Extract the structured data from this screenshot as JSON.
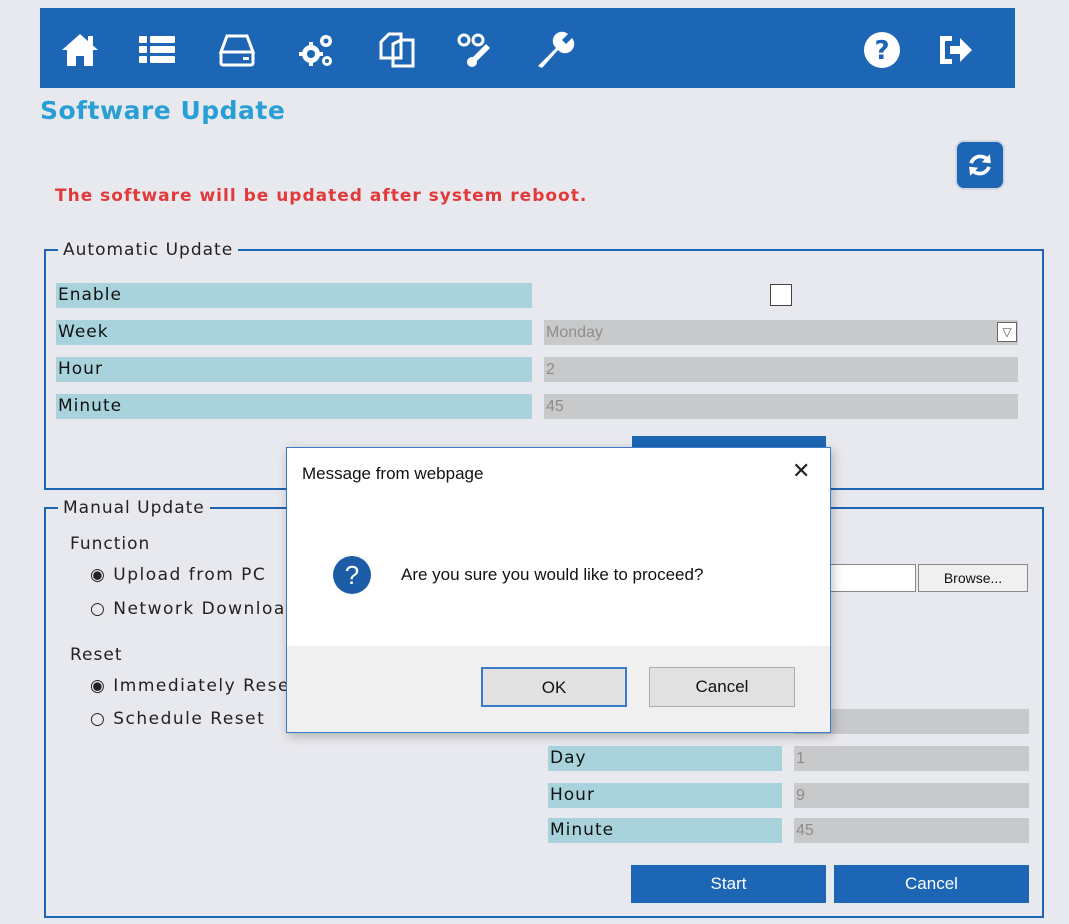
{
  "nav": {
    "icons": [
      "home-icon",
      "list-icon",
      "drive-icon",
      "gears-icon",
      "copy-icon",
      "network-settings-icon",
      "wrench-icon",
      "help-icon",
      "logout-icon"
    ]
  },
  "page": {
    "title": "Software Update",
    "notice": "The software will be updated after system reboot."
  },
  "automatic": {
    "legend": "Automatic Update",
    "enable_label": "Enable",
    "week_label": "Week",
    "week_value": "Monday",
    "hour_label": "Hour",
    "hour_value": "2",
    "minute_label": "Minute",
    "minute_value": "45"
  },
  "manual": {
    "legend": "Manual Update",
    "function_label": "Function",
    "function_options": [
      "Upload from PC",
      "Network Download"
    ],
    "reset_label": "Reset",
    "reset_options": [
      "Immediately Reset",
      "Schedule Reset"
    ],
    "browse_label": "Browse...",
    "day_label": "Day",
    "day_value": "1",
    "hour_label": "Hour",
    "hour_value": "9",
    "minute_label": "Minute",
    "minute_value": "45",
    "start_label": "Start",
    "cancel_label": "Cancel"
  },
  "dialog": {
    "title": "Message from webpage",
    "close": "✕",
    "icon_glyph": "?",
    "message": "Are you sure you would like to proceed?",
    "ok_label": "OK",
    "cancel_label": "Cancel"
  },
  "colors": {
    "brand": "#1d66b5",
    "title": "#2a9fd6",
    "notice": "#e23a3a",
    "label_bg": "#a9d3dc"
  }
}
